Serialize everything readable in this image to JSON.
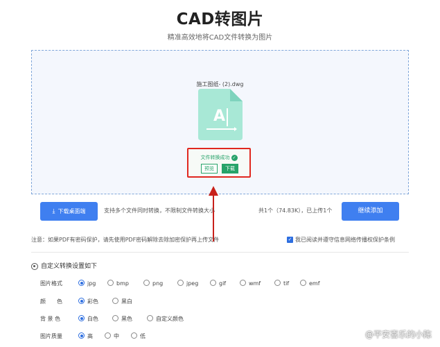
{
  "header": {
    "title": "CAD转图片",
    "subtitle": "精准高效地将CAD文件转换为图片"
  },
  "dropzone": {
    "file_name": "施工图纸- (2).dwg",
    "file_icon_letter": "A",
    "status": "文件转换成功",
    "preview_label": "预览",
    "download_label": "下载",
    "accent_color": "#27a36a",
    "highlight_color": "#e0271f"
  },
  "toolbar": {
    "download_client_label": "下载桌面端",
    "batch_tip": "支持多个文件同时转换，不限制文件转换大小",
    "file_count": "共1个（74.83K），已上传1个",
    "continue_label": "继续添加"
  },
  "notice": "注意：如果PDF有密码保护，请先使用PDF密码解除去除加密保护再上传文件",
  "agree_label": "我已阅读并遵守信息网络传播权保护条例",
  "settings": {
    "heading": "自定义转换设置如下",
    "format": {
      "label": "图片格式",
      "options": [
        "jpg",
        "bmp",
        "png",
        "jpeg",
        "gif",
        "wmf",
        "tif",
        "emf"
      ],
      "selected": "jpg"
    },
    "color": {
      "label": "颜　　色",
      "options": [
        "彩色",
        "黑白"
      ],
      "selected": "彩色"
    },
    "background": {
      "label": "背 景 色",
      "options": [
        "白色",
        "黑色",
        "自定义颜色"
      ],
      "selected": "白色"
    },
    "quality": {
      "label": "图片质量",
      "options": [
        "高",
        "中",
        "低"
      ],
      "selected": "高"
    }
  },
  "watermark": "@平安喜乐的小陈"
}
